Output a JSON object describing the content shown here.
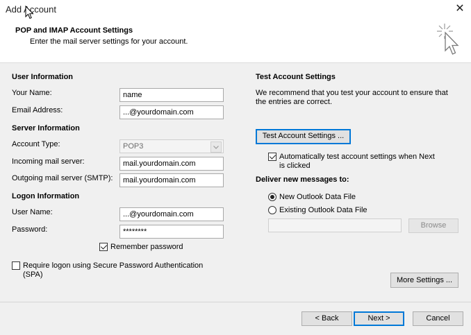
{
  "window": {
    "title": "Add Account"
  },
  "header": {
    "title": "POP and IMAP Account Settings",
    "subtitle": "Enter the mail server settings for your account."
  },
  "left": {
    "user_info": {
      "heading": "User Information",
      "name_label": "Your Name:",
      "name_value": "name",
      "email_label": "Email Address:",
      "email_value": "...@yourdomain.com"
    },
    "server_info": {
      "heading": "Server Information",
      "account_type_label": "Account Type:",
      "account_type_value": "POP3",
      "incoming_label": "Incoming mail server:",
      "incoming_value": "mail.yourdomain.com",
      "outgoing_label": "Outgoing mail server (SMTP):",
      "outgoing_value": "mail.yourdomain.com"
    },
    "logon_info": {
      "heading": "Logon Information",
      "username_label": "User Name:",
      "username_value": "...@yourdomain.com",
      "password_label": "Password:",
      "password_value": "********",
      "remember_label": "Remember password",
      "remember_checked": true,
      "spa_label_line1": "Require logon using Secure Password Authentication",
      "spa_label_line2": "(SPA)",
      "spa_checked": false
    }
  },
  "right": {
    "heading": "Test Account Settings",
    "description_line1": "We recommend that you test your account to ensure that",
    "description_line2": "the entries are correct.",
    "test_button": "Test Account Settings ...",
    "auto_test_line1": "Automatically test account settings when Next",
    "auto_test_line2": "is clicked",
    "auto_test_checked": true,
    "deliver_heading": "Deliver new messages to:",
    "new_file_label": "New Outlook Data File",
    "existing_file_label": "Existing Outlook Data File",
    "selected": "new",
    "existing_path_value": "",
    "browse_button": "Browse",
    "more_settings_button": "More Settings ..."
  },
  "footer": {
    "back_button": "< Back",
    "next_button": "Next >",
    "cancel_button": "Cancel"
  }
}
